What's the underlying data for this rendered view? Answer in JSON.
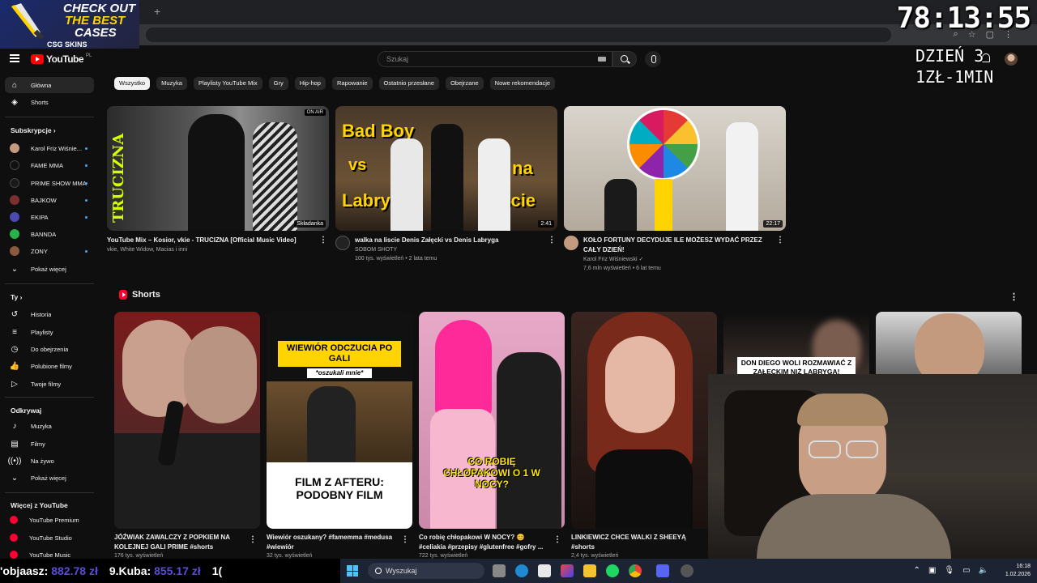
{
  "promo": {
    "line1": "CHECK OUT",
    "line2": "THE BEST",
    "line3": "CASES",
    "brand": "CSG SKINS"
  },
  "overlay": {
    "timer": "78:13:55",
    "day": "DZIEŃ 3",
    "rate": "1ZŁ-1MIN"
  },
  "header": {
    "logo": "YouTube",
    "region": "PL",
    "search_placeholder": "Szukaj"
  },
  "sidebar": {
    "main": [
      {
        "label": "Główna",
        "icon": "home-icon"
      },
      {
        "label": "Shorts",
        "icon": "shorts-icon"
      }
    ],
    "subs_title": "Subskrypcje",
    "subs": [
      {
        "label": "Karol Friz Wiśnie...",
        "color": "#c49a80",
        "live": true
      },
      {
        "label": "FAME MMA",
        "color": "#111111",
        "live": true
      },
      {
        "label": "PRIME SHOW MMA",
        "color": "#1a1a1a",
        "live": true
      },
      {
        "label": "BAJKOW",
        "color": "#7b3030",
        "live": true
      },
      {
        "label": "EKIPA",
        "color": "#4a4ab0",
        "live": true
      },
      {
        "label": "BANNDA",
        "color": "#27b34a",
        "live": false
      },
      {
        "label": "ZONY",
        "color": "#8a5a40",
        "live": true
      }
    ],
    "subs_more": "Pokaż więcej",
    "you_title": "Ty",
    "you": [
      {
        "label": "Historia",
        "icon": "history-icon"
      },
      {
        "label": "Playlisty",
        "icon": "playlist-icon"
      },
      {
        "label": "Do obejrzenia",
        "icon": "watch-later-icon"
      },
      {
        "label": "Polubione filmy",
        "icon": "like-icon"
      },
      {
        "label": "Twoje filmy",
        "icon": "your-videos-icon"
      }
    ],
    "explore_title": "Odkrywaj",
    "explore": [
      {
        "label": "Muzyka",
        "icon": "music-icon"
      },
      {
        "label": "Filmy",
        "icon": "film-icon"
      },
      {
        "label": "Na żywo",
        "icon": "live-icon"
      },
      {
        "label": "Pokaż więcej",
        "icon": "chevron-down-icon"
      }
    ],
    "more_title": "Więcej z YouTube",
    "more": [
      {
        "label": "YouTube Premium"
      },
      {
        "label": "YouTube Studio"
      },
      {
        "label": "YouTube Music"
      }
    ]
  },
  "chips": [
    "Wszystko",
    "Muzyka",
    "Playlisty YouTube Mix",
    "Gry",
    "Hip-hop",
    "Rapowanie",
    "Ostatnio przesłane",
    "Obejrzane",
    "Nowe rekomendacje"
  ],
  "videos": [
    {
      "title": "YouTube Mix – Kosior, vkie - TRUCIZNA [Official Music Video]",
      "channel": "vkie, White Widow, Macias i inni",
      "meta": "",
      "badge": "Składanka",
      "onair": "ON AIR"
    },
    {
      "title": "walka na liscie Denis Załęcki vs Denis Labryga",
      "channel": "SOBOM SHOTY",
      "meta": "100 tys. wyświetleń • 2 lata temu",
      "duration": "2:41",
      "t1": "Bad Boy",
      "t2": "vs",
      "t3": "Labryga",
      "t4": "na",
      "t5": "liście"
    },
    {
      "title": "KOŁO FORTUNY DECYDUJE ILE MOŻESZ WYDAĆ PRZEZ CAŁY DZIEŃ!",
      "channel": "Karol Friz Wiśniewski",
      "meta": "7,6 mln wyświetleń • 6 lat temu",
      "duration": "22:17"
    }
  ],
  "shorts_title": "Shorts",
  "shorts": [
    {
      "title": "JÓŹWIAK ZAWALCZY Z POPKIEM NA KOLEJNEJ GALI PRIME #shorts",
      "views": "176 tys. wyświetleń"
    },
    {
      "title": "Wiewiór oszukany? #famemma #medusa #wiewiór",
      "views": "32 tys. wyświetleń",
      "cap1": "WIEWIÓR ODCZUCIA PO GALI",
      "cap2": "*oszukali mnie*",
      "cap3": "FILM Z AFTERU: PODOBNY FILM"
    },
    {
      "title": "Co robię chłopakowi W NOCY? 😊 #celiakia #przepisy #glutenfree #gofry ...",
      "views": "722 tys. wyświetleń",
      "cap": "CO ROBIĘ CHŁOPAKOWI O 1 W NOCY?"
    },
    {
      "title": "LINKIEWICZ CHCE WALKI Z SHEEYĄ #shorts",
      "views": "2,4 tys. wyświetleń"
    }
  ],
  "overlay_caption": "DON DIEGO WOLI ROZMAWIAĆ Z ZAŁĘCKIM NIŻ LABRYGĄ!",
  "ticker": [
    {
      "name": "'objaasz:",
      "value": "882.78 zł"
    },
    {
      "name": "9.Kuba:",
      "value": "855.17 zł"
    },
    {
      "name": "1(",
      "value": ""
    }
  ],
  "taskbar": {
    "search": "Wyszukaj",
    "time": "16:18",
    "date": "1.02.2026"
  }
}
